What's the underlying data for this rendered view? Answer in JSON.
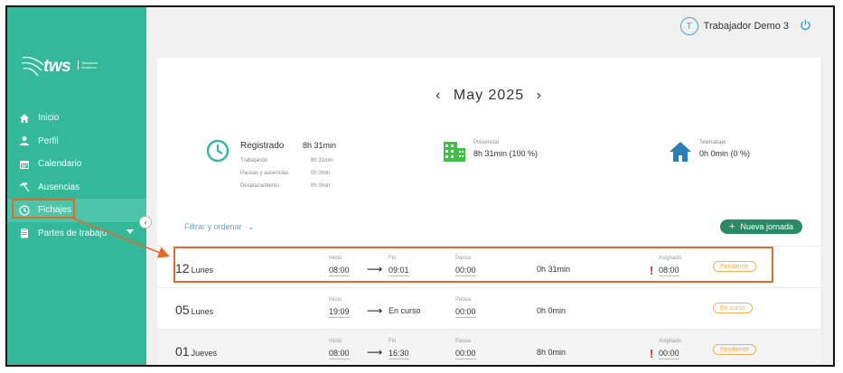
{
  "brand": {
    "logo_text": "tws",
    "logo_tagline": "Teamwork Solutions"
  },
  "sidebar": {
    "items": [
      {
        "label": "Inicio",
        "icon": "home-icon"
      },
      {
        "label": "Perfil",
        "icon": "person-icon"
      },
      {
        "label": "Calendario",
        "icon": "calendar-icon"
      },
      {
        "label": "Ausencias",
        "icon": "beach-umbrella-icon"
      },
      {
        "label": "Fichajes",
        "icon": "clock-icon",
        "active": true
      },
      {
        "label": "Partes de trabajo",
        "icon": "clipboard-icon",
        "has_dropdown": true
      }
    ]
  },
  "header": {
    "avatar_initial": "T",
    "user_name": "Trabajador Demo 3"
  },
  "main": {
    "month_label": "May 2025",
    "registrado": {
      "title": "Registrado",
      "total": "8h 31min",
      "rows": [
        {
          "label": "Trabajando",
          "value": "8h 31min"
        },
        {
          "label": "Pausas y ausencias",
          "value": "0h 0min"
        },
        {
          "label": "Desplazamiento",
          "value": "0h 0min"
        }
      ]
    },
    "presencial": {
      "label": "Presencial",
      "value": "8h 31min (100 %)"
    },
    "teletrabajo": {
      "label": "Teletrabajo",
      "value": "0h 0min (0 %)"
    },
    "filter_label": "Filtrar y ordenar",
    "new_button_label": "Nueva jornada",
    "entries": [
      {
        "day_number": "12",
        "day_name": "Lunes",
        "inicio_label": "Inicio",
        "inicio": "08:00",
        "fin_label": "Fin",
        "fin": "09:01",
        "pausa_label": "Pausa",
        "pausa": "00:00",
        "total": "0h 31min",
        "asignado_label": "Asignado",
        "asignado": "08:00",
        "warning": "!",
        "status": "Pendiente"
      },
      {
        "day_number": "05",
        "day_name": "Lunes",
        "inicio_label": "Inicio",
        "inicio": "19:09",
        "fin_label": "Fin",
        "fin": "En curso",
        "pausa_label": "Pausa",
        "pausa": "00:00",
        "total": "0h 0min",
        "status": "En curso"
      },
      {
        "day_number": "01",
        "day_name": "Jueves",
        "inicio_label": "Inicio",
        "inicio": "08:00",
        "fin_label": "Fin",
        "fin": "16:30",
        "pausa_label": "Pausa",
        "pausa": "00:00",
        "total": "8h 0min",
        "asignado_label": "Asignado",
        "asignado": "00:00",
        "warning": "!",
        "status": "Pendiente"
      }
    ]
  },
  "colors": {
    "sidebar": "#34b89a",
    "accent_green": "#2b8a66",
    "highlight_orange": "#e26a2c",
    "status_orange": "#f2b05a",
    "warning_red": "#d42a2a",
    "link_blue": "#6aa6c8"
  }
}
